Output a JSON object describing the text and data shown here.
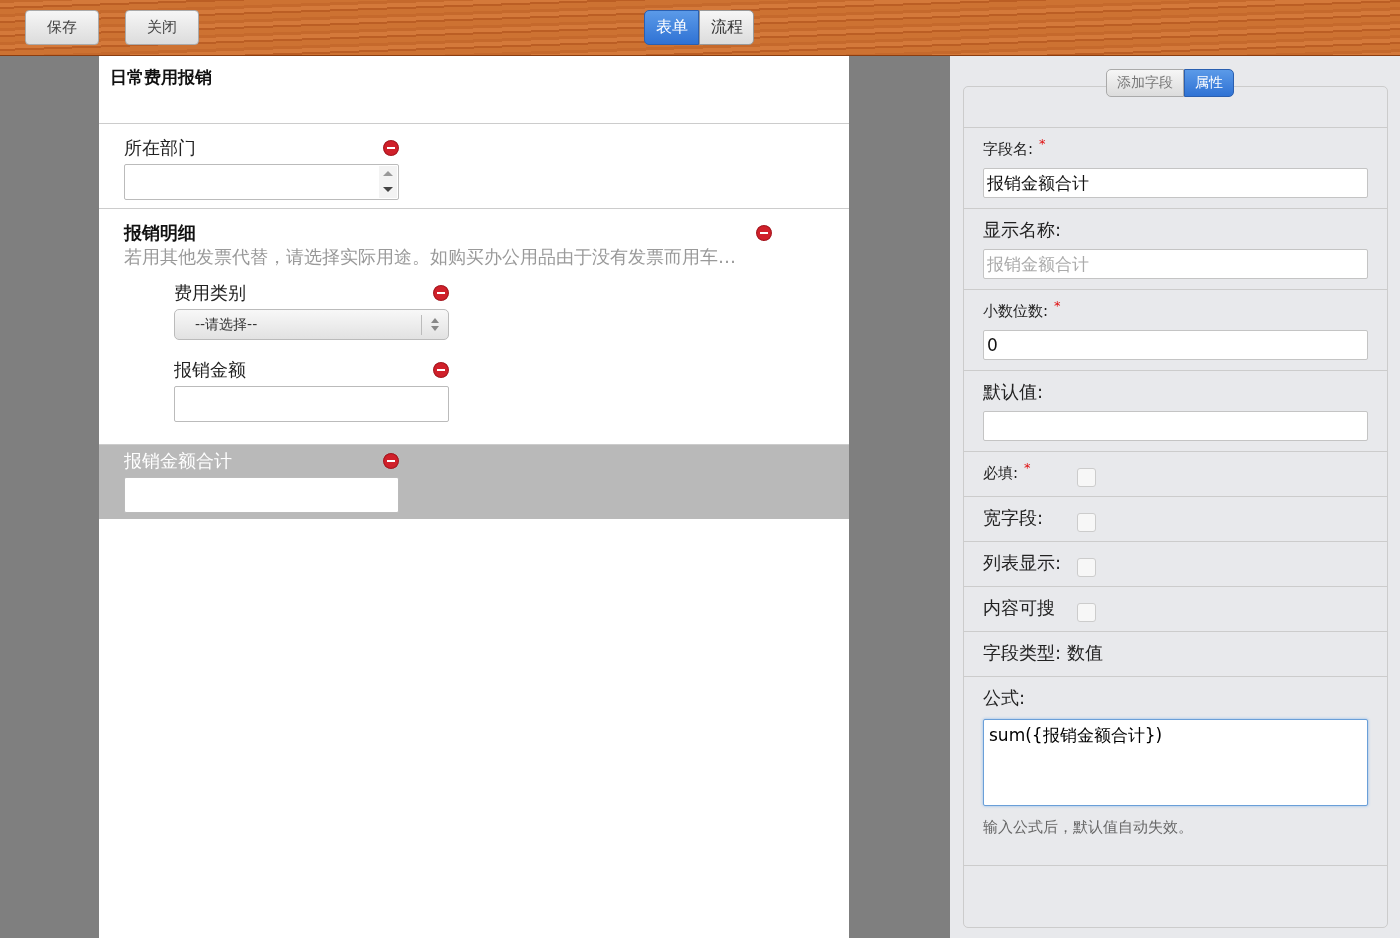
{
  "toolbar": {
    "buttons": [
      "保存",
      "关闭"
    ],
    "tabs": [
      {
        "label": "表单",
        "selected": true
      },
      {
        "label": "流程",
        "selected": false
      }
    ]
  },
  "form": {
    "title": "日常费用报销",
    "fields": [
      {
        "kind": "spinner",
        "label": "所在部门",
        "selected": false
      },
      {
        "kind": "group",
        "label": "报销明细",
        "description": "若用其他发票代替，请选择实际用途。如购买办公用品由于没有发票而用车…",
        "selected": false,
        "children": [
          {
            "kind": "select",
            "label": "费用类别",
            "value": "--请选择--"
          },
          {
            "kind": "text",
            "label": "报销金额"
          }
        ]
      },
      {
        "kind": "text",
        "label": "报销金额合计",
        "selected": true
      }
    ]
  },
  "panel": {
    "tabs": [
      {
        "label": "添加字段",
        "selected": false
      },
      {
        "label": "属性",
        "selected": true
      }
    ],
    "properties": [
      {
        "kind": "input",
        "label": "字段名:",
        "required_mark": "*",
        "value": "报销金额合计"
      },
      {
        "kind": "input",
        "label": "显示名称:",
        "placeholder": "报销金额合计"
      },
      {
        "kind": "input",
        "label": "小数位数:",
        "required_mark": "*",
        "value": "0"
      },
      {
        "kind": "input",
        "label": "默认值:"
      },
      {
        "kind": "checkbox",
        "label": "必填:",
        "required_mark": "*",
        "checked": false
      },
      {
        "kind": "checkbox",
        "label": "宽字段:",
        "checked": false
      },
      {
        "kind": "checkbox",
        "label": "列表显示:",
        "checked": false
      },
      {
        "kind": "checkbox",
        "label": "内容可搜",
        "checked": false
      },
      {
        "kind": "static",
        "label": "字段类型: 数值"
      },
      {
        "kind": "textarea",
        "label": "公式:",
        "value": "sum({报销金额合计})",
        "hint": "输入公式后，默认值自动失效。"
      }
    ]
  }
}
